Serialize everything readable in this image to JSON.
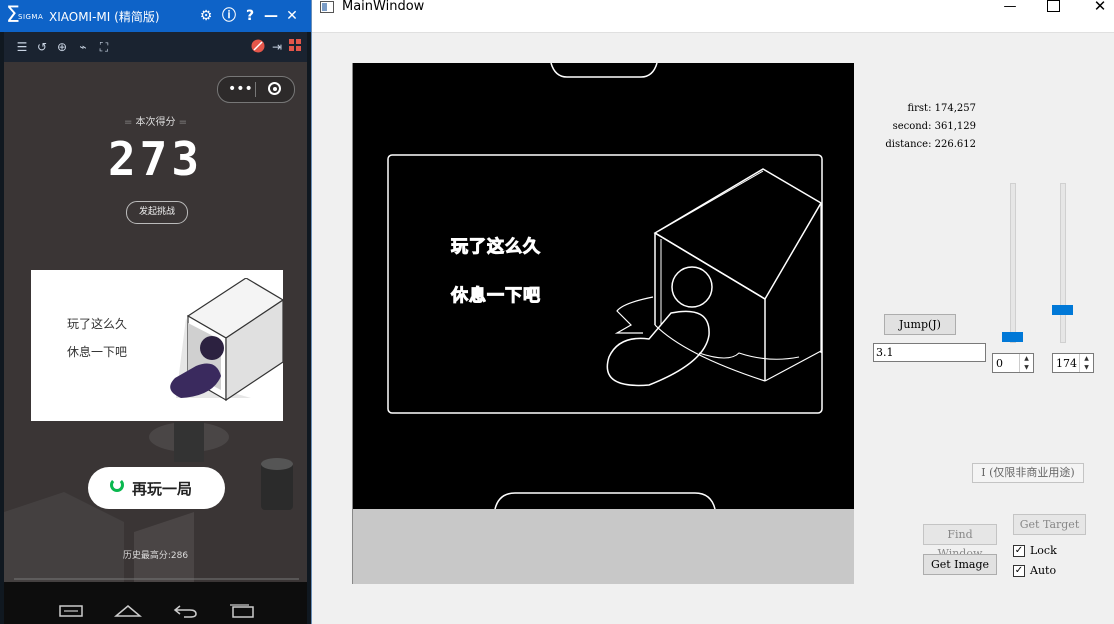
{
  "phone_window": {
    "title": "XIAOMI-MI (精简版)",
    "logo": "SIGMA",
    "title_icons": [
      "gear-icon",
      "info-icon",
      "help-icon",
      "minimize-icon",
      "close-icon"
    ],
    "toolbar_icons": [
      "list-icon",
      "rotate-icon",
      "zoom-icon",
      "wifi-icon",
      "fullscreen-icon",
      "mute-icon",
      "export-icon",
      "grid-icon"
    ]
  },
  "game": {
    "score_label": "本次得分",
    "score": "273",
    "challenge_button": "发起挑战",
    "card_line1": "玩了这么久",
    "card_line2": "休息一下吧",
    "replay_button": "再玩一局",
    "best_score_label": "历史最高分:",
    "best_score": "286"
  },
  "main_window": {
    "title": "MainWindow",
    "edge_text_line1": "玩了这么久",
    "edge_text_line2": "休息一下吧",
    "info": {
      "first_label": "first:",
      "first_value": "174,257",
      "second_label": "second:",
      "second_value": "361,129",
      "distance_label": "distance:",
      "distance_value": "226.612"
    },
    "jump_button": "Jump(J)",
    "factor_input": "3.1",
    "spin_left_value": "0",
    "spin_right_value": "174",
    "license_label": "I (仅限非商业用途)",
    "find_window_button": "Find Window",
    "get_target_button": "Get Target",
    "get_image_button": "Get Image",
    "lock_label": "Lock",
    "auto_label": "Auto",
    "lock_checked": true,
    "auto_checked": true
  },
  "colors": {
    "accent": "#0078d7",
    "phone_title": "#0e63c8",
    "game_bg": "#3a3535"
  }
}
